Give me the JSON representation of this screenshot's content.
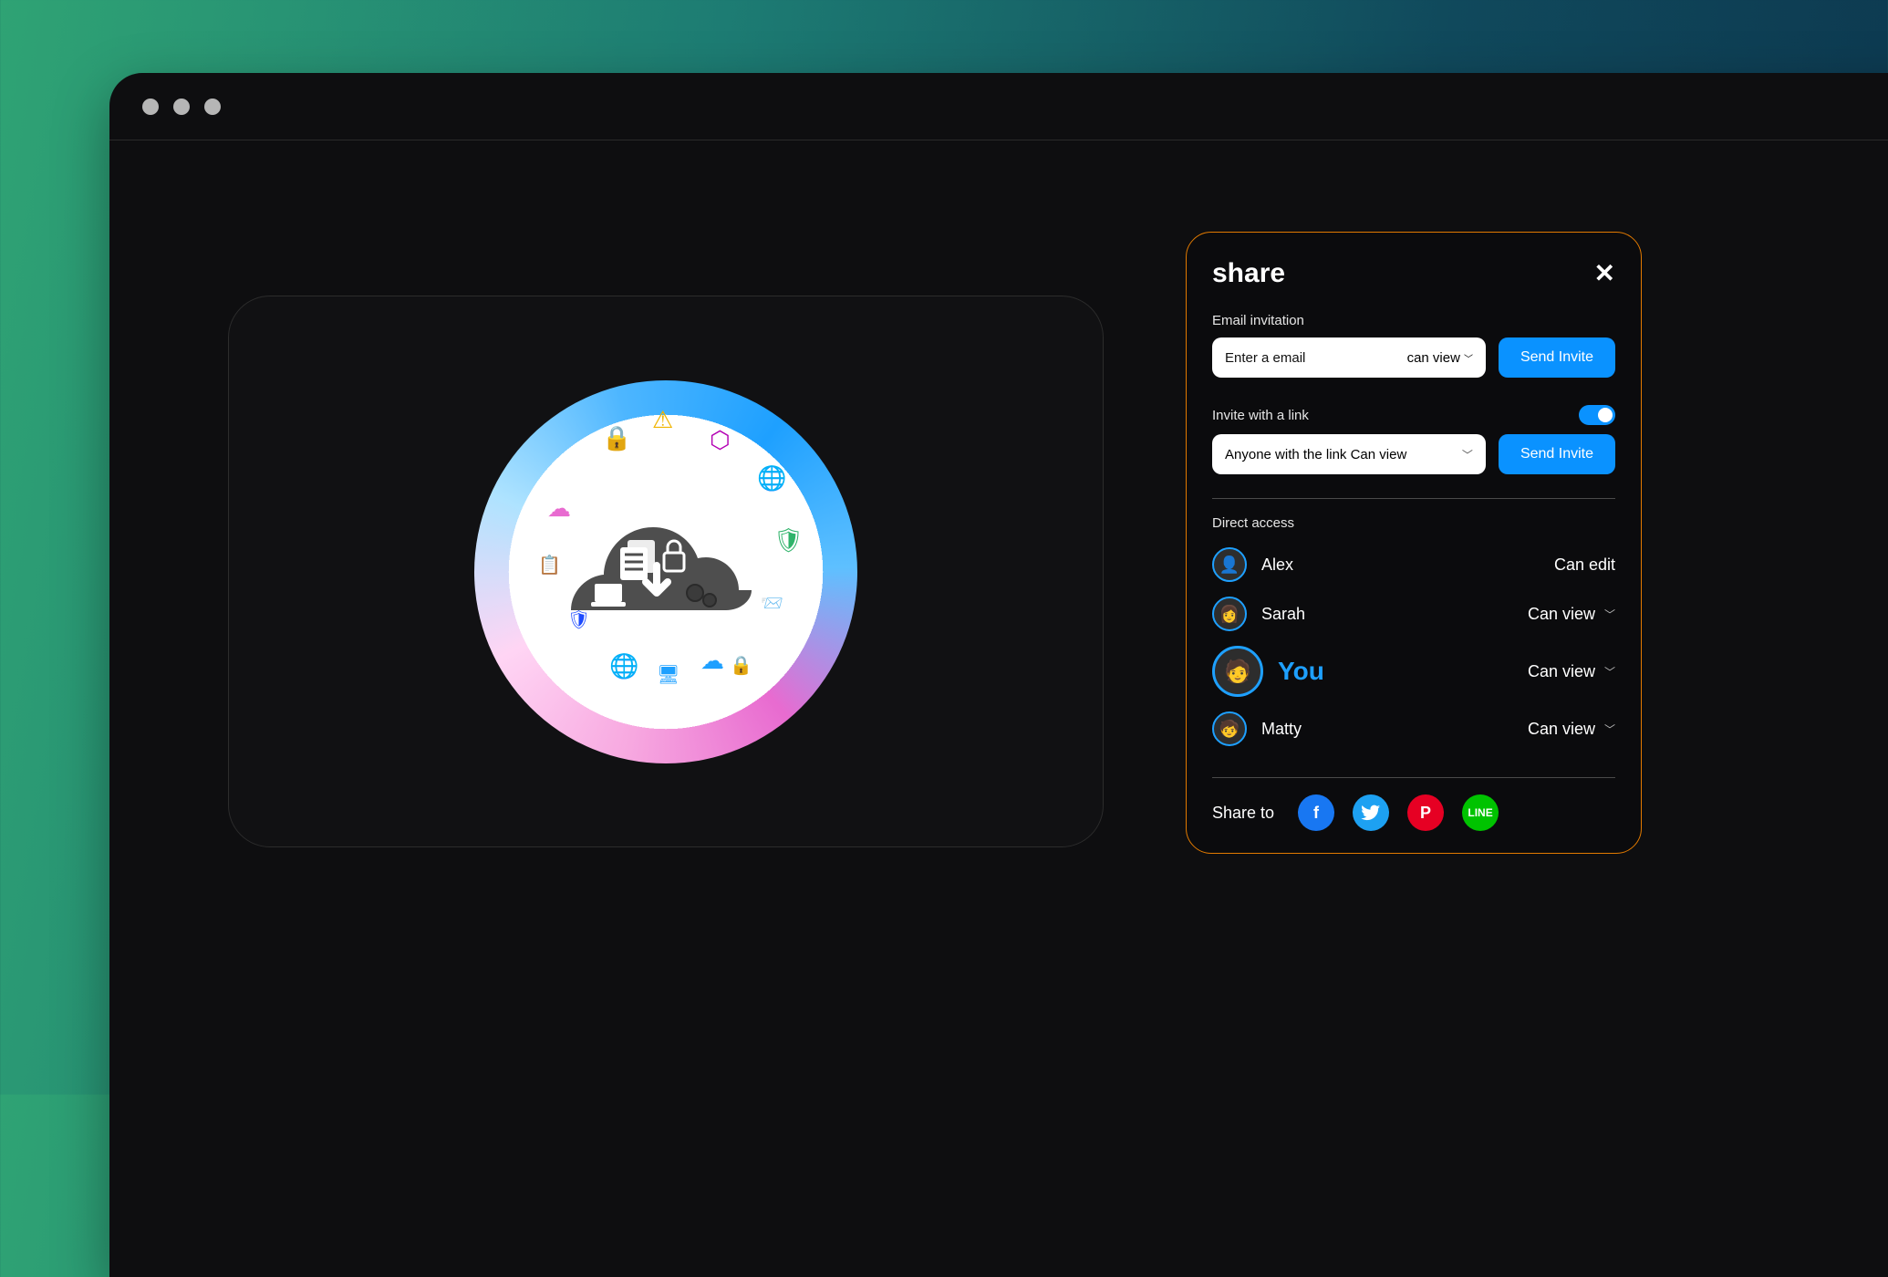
{
  "share": {
    "title": "share",
    "email_section_label": "Email invitation",
    "email_placeholder": "Enter a email",
    "email_permission": "can view",
    "send_invite_label": "Send Invite",
    "link_section_label": "Invite with a link",
    "link_select_value": "Anyone with the link Can view",
    "link_toggle_on": true,
    "direct_access_label": "Direct access",
    "members": [
      {
        "name": "Alex",
        "permission": "Can edit",
        "has_caret": false,
        "is_you": false
      },
      {
        "name": "Sarah",
        "permission": "Can view",
        "has_caret": true,
        "is_you": false
      },
      {
        "name": "You",
        "permission": "Can view",
        "has_caret": true,
        "is_you": true
      },
      {
        "name": "Matty",
        "permission": "Can view",
        "has_caret": true,
        "is_you": false
      }
    ],
    "share_to_label": "Share to",
    "socials": {
      "facebook": "facebook",
      "twitter": "twitter",
      "pinterest": "pinterest",
      "line": "LINE"
    }
  },
  "colors": {
    "accent": "#0a92ff",
    "panel_border": "#e27a00"
  }
}
